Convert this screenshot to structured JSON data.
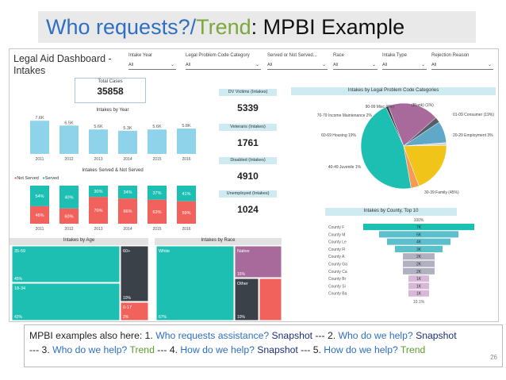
{
  "slide": {
    "title_part1": "Who requests?/",
    "title_part2": "Trend",
    "title_part3": ": MPBI Example"
  },
  "dashboard": {
    "title": "Legal Aid Dashboard - Intakes",
    "filters": [
      {
        "label": "Intake Year",
        "value": "All"
      },
      {
        "label": "Legal Problem Code Category",
        "value": "All"
      },
      {
        "label": "Served or Not Served...",
        "value": "All"
      },
      {
        "label": "Race",
        "value": "All"
      },
      {
        "label": "Intake Type",
        "value": "All"
      },
      {
        "label": "Rejection Reason",
        "value": "All"
      }
    ],
    "total_cases": {
      "label": "Total Cases",
      "value": "35858"
    },
    "kpis": [
      {
        "label": "DV Victims (Intakes)",
        "value": "5339"
      },
      {
        "label": "Veterans (Intakes)",
        "value": "1761"
      },
      {
        "label": "Disabled (Intakes)",
        "value": "4910"
      },
      {
        "label": "Unemployed (Intakes)",
        "value": "1024"
      }
    ],
    "colors": {
      "teal": "#1dbfb3",
      "red": "#f2625c",
      "lightblue": "#8fd3ea",
      "dark": "#3a4149",
      "purple": "#a86a9b",
      "yellow": "#f0c419",
      "orange": "#f59b5a"
    }
  },
  "chart_data": [
    {
      "type": "bar",
      "title": "Intakes by Year",
      "categories": [
        "2011",
        "2012",
        "2013",
        "2014",
        "2015",
        "2016"
      ],
      "values": [
        7.6,
        6.5,
        5.6,
        5.3,
        5.6,
        5.8
      ],
      "labels": [
        "7.6K",
        "6.5K",
        "5.6K",
        "5.3K",
        "5.6K",
        "5.8K"
      ],
      "ylim": [
        0,
        8
      ]
    },
    {
      "type": "bar",
      "title": "Intakes Served & Not Served",
      "legend": [
        "Not Served",
        "Served"
      ],
      "categories": [
        "2011",
        "2012",
        "2013",
        "2014",
        "2015",
        "2016"
      ],
      "series": [
        {
          "name": "Not Served",
          "values": [
            46,
            40,
            70,
            66,
            63,
            59
          ],
          "labels": [
            "46%",
            "60%",
            "70%",
            "66%",
            "63%",
            "59%"
          ]
        },
        {
          "name": "Served",
          "values": [
            54,
            60,
            30,
            34,
            37,
            41
          ],
          "labels": [
            "54%",
            "40%",
            "30%",
            "34%",
            "37%",
            "41%"
          ]
        }
      ]
    },
    {
      "type": "pie",
      "title": "Intakes by Legal Problem Code Categories",
      "slices": [
        {
          "label": "30-39 Family (45%)",
          "value": 45
        },
        {
          "label": "40-49 Juvenile 1%",
          "value": 1
        },
        {
          "label": "60-69 Housing 19%",
          "value": 19
        },
        {
          "label": "70-79 Income Maintenance 2%",
          "value": 2
        },
        {
          "label": "90-99 Misc (8%)",
          "value": 8
        },
        {
          "label": "(Blank) (1%)",
          "value": 1
        },
        {
          "label": "01-09 Consumer (19%)",
          "value": 19
        },
        {
          "label": "20-29 Employment 3%",
          "value": 3
        }
      ]
    },
    {
      "type": "bar",
      "title": "Intakes by County, Top 10",
      "categories": [
        "County F",
        "County M",
        "County Le",
        "County Fl",
        "County A",
        "County Ga",
        "County Ca",
        "County Br",
        "County Si",
        "County Ba"
      ],
      "values": [
        7,
        5,
        4,
        3,
        2,
        2,
        2,
        1,
        1,
        1
      ],
      "labels": [
        "7K",
        "5K",
        "4K",
        "3K",
        "2K",
        "2K",
        "2K",
        "1K",
        "1K",
        "1K"
      ],
      "top_label": "100%",
      "bottom_label": "10.1%"
    },
    {
      "type": "heatmap",
      "title": "Intakes by Age",
      "cells": [
        {
          "label": "35-59",
          "pct": "45%"
        },
        {
          "label": "18-34",
          "pct": "42%"
        },
        {
          "label": "60+",
          "pct": "10%"
        },
        {
          "label": "0-17",
          "pct": "2%"
        }
      ]
    },
    {
      "type": "heatmap",
      "title": "Intakes by Race",
      "cells": [
        {
          "label": "White",
          "pct": "67%"
        },
        {
          "label": "Native",
          "pct": "15%"
        },
        {
          "label": "Other",
          "pct": "10%"
        }
      ]
    }
  ],
  "caption": {
    "s1": "MPBI examples also here: 1. ",
    "s2": "Who requests assistance?",
    "s3": " Snapshot",
    "s4": " --- 2. ",
    "s5": "Who do we help?",
    "s6": " Snapshot",
    "s7": "--- 3. ",
    "s8": "Who do we help?",
    "s9": " Trend",
    "s10": " --- 4. ",
    "s11": "How do we help?",
    "s12": " Snapshot",
    "s13": " --- 5. ",
    "s14": "How do we help?",
    "s15": " Trend"
  },
  "page_number": "26"
}
